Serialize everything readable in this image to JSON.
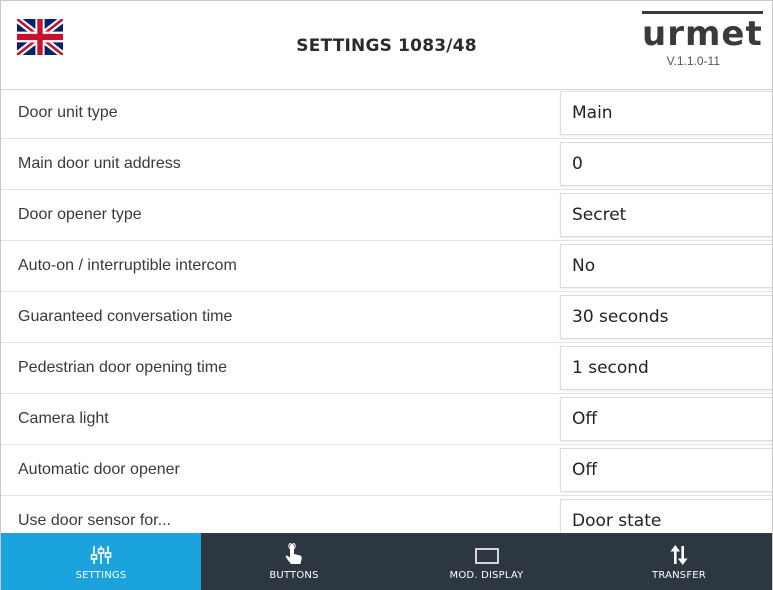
{
  "header": {
    "title": "SETTINGS 1083/48",
    "brand": "urmet",
    "version": "V.1.1.0-11",
    "language_flag_icon": "uk-flag-icon"
  },
  "settings": [
    {
      "label": "Door unit type",
      "value": "Main"
    },
    {
      "label": "Main door unit address",
      "value": "0"
    },
    {
      "label": "Door opener type",
      "value": "Secret"
    },
    {
      "label": "Auto-on / interruptible intercom",
      "value": "No"
    },
    {
      "label": "Guaranteed conversation time",
      "value": "30 seconds"
    },
    {
      "label": "Pedestrian door opening time",
      "value": "1 second"
    },
    {
      "label": "Camera light",
      "value": "Off"
    },
    {
      "label": "Automatic door opener",
      "value": "Off"
    },
    {
      "label": "Use door sensor for...",
      "value": "Door state"
    }
  ],
  "tabs": [
    {
      "label": "SETTINGS",
      "icon": "sliders-icon",
      "active": true
    },
    {
      "label": "BUTTONS",
      "icon": "hand-pointer-icon",
      "active": false
    },
    {
      "label": "MOD. DISPLAY",
      "icon": "display-icon",
      "active": false
    },
    {
      "label": "TRANSFER",
      "icon": "transfer-arrows-icon",
      "active": false
    }
  ],
  "colors": {
    "tab_bar": "#2c3742",
    "tab_active": "#1aa3dd",
    "flag_blue": "#012169",
    "flag_red": "#C8102E"
  }
}
